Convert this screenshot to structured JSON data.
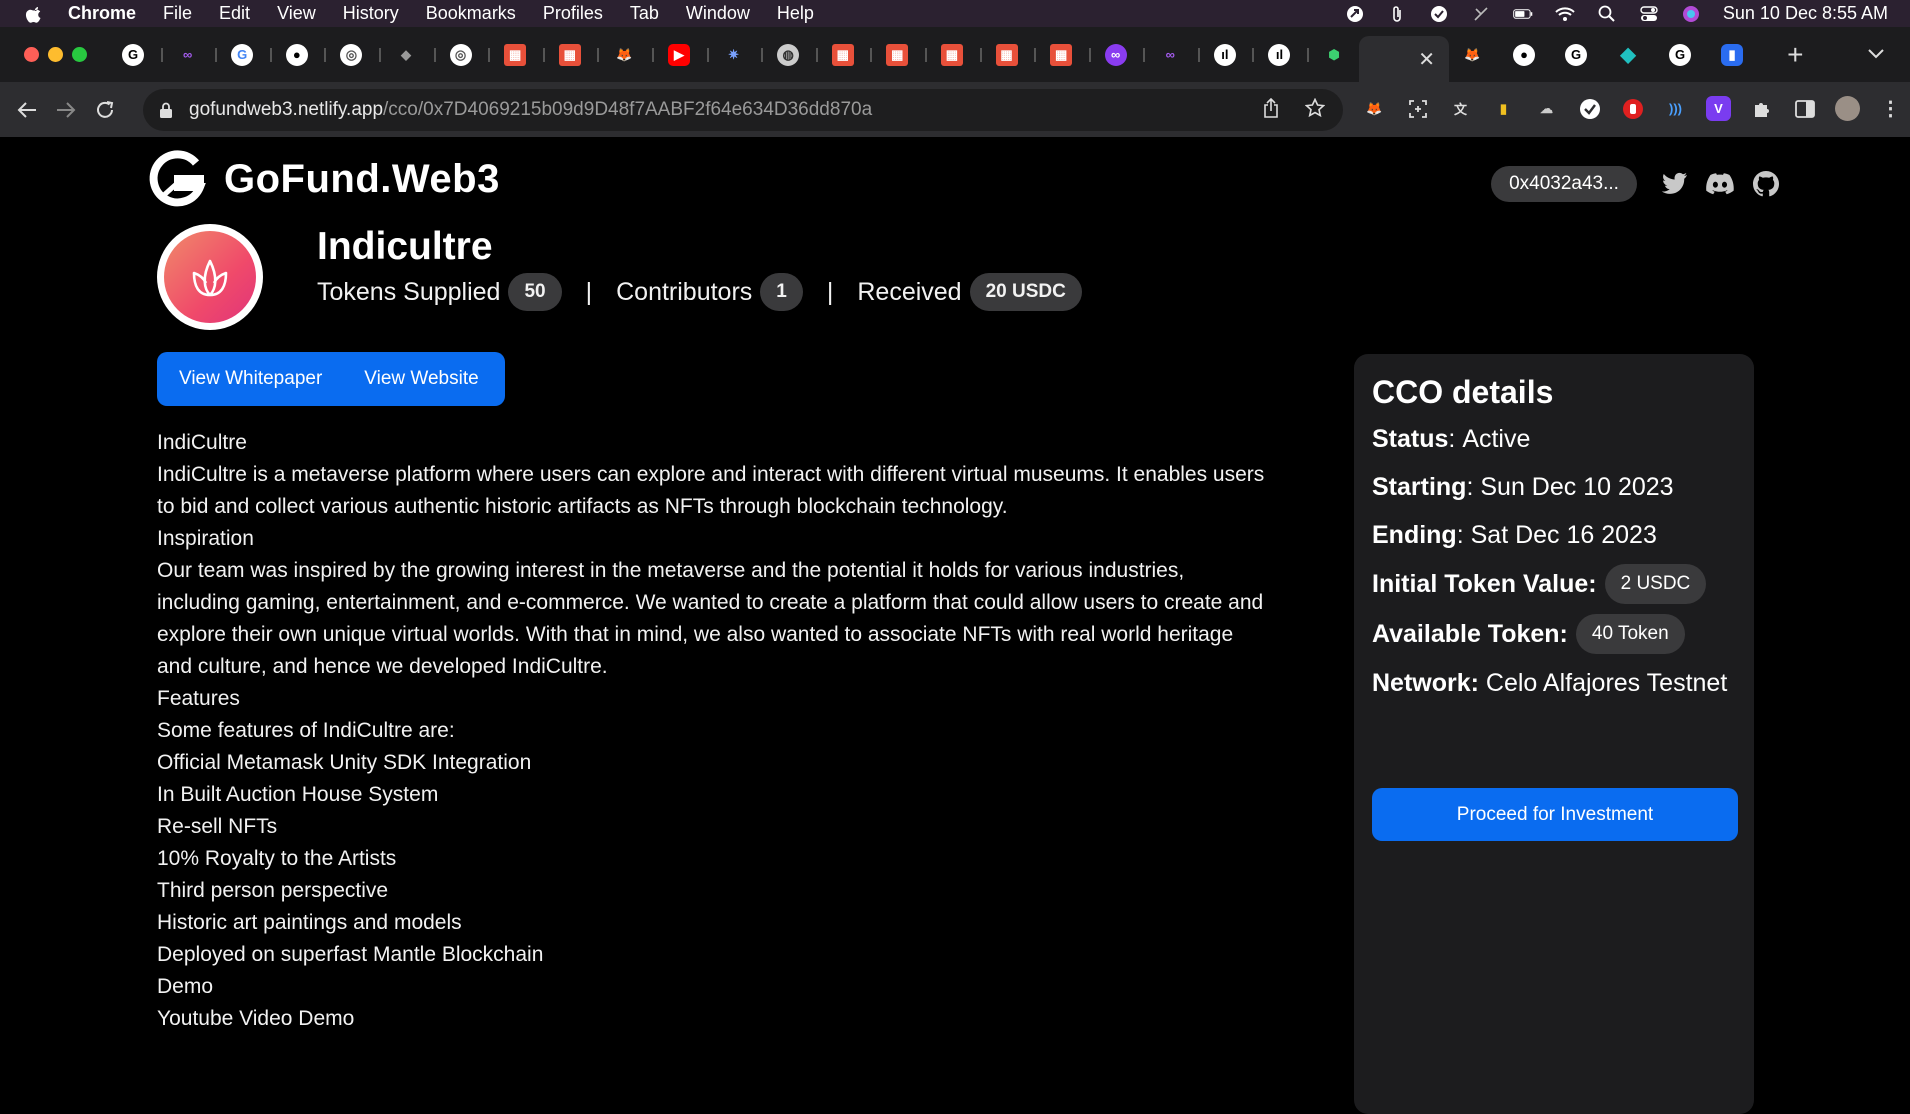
{
  "menubar": {
    "app": "Chrome",
    "items": [
      "File",
      "Edit",
      "View",
      "History",
      "Bookmarks",
      "Profiles",
      "Tab",
      "Window",
      "Help"
    ],
    "clock": "Sun 10 Dec  8:55 AM"
  },
  "tabs": {
    "favicons": [
      "gofund-g",
      "chain-link",
      "google",
      "github",
      "chrome-dev",
      "vector-app",
      "chrome-dev",
      "grid-app",
      "grid-app",
      "metamask",
      "youtube",
      "spark-app",
      "globe",
      "grid-app",
      "grid-app",
      "grid-app",
      "grid-app",
      "grid-app",
      "purple-link",
      "purple-link",
      "chart-app",
      "chart-app",
      "green-cube"
    ],
    "active_close": "✕",
    "after_active": [
      "metamask",
      "github",
      "gofund-g",
      "diamond-app",
      "gofund-g",
      "blue-app"
    ],
    "new_tab": "+"
  },
  "toolbar": {
    "url_host": "gofundweb3.netlify.app",
    "url_path": "/cco/0x7D4069215b09d9D48f7AABF2f64e634D36dd870a"
  },
  "site": {
    "name": "GoFund.Web3",
    "wallet": "0x4032a43...",
    "social": [
      "twitter-icon",
      "discord-icon",
      "github-icon"
    ]
  },
  "project": {
    "title": "Indicultre",
    "tokens_supplied_label": "Tokens Supplied",
    "tokens_supplied": "50",
    "contributors_label": "Contributors",
    "contributors": "1",
    "received_label": "Received",
    "received": "20 USDC",
    "separator": "|",
    "whitepaper_label": "View Whitepaper",
    "website_label": "View Website"
  },
  "description": [
    "IndiCultre",
    "IndiCultre is a metaverse platform where users can explore and interact with different virtual museums. It enables users to bid and collect various authentic historic artifacts as NFTs through blockchain technology.",
    "Inspiration",
    "Our team was inspired by the growing interest in the metaverse and the potential it holds for various industries, including gaming, entertainment, and e-commerce. We wanted to create a platform that could allow users to create and explore their own unique virtual worlds. With that in mind, we also wanted to associate NFTs with real world heritage and culture, and hence we developed IndiCultre.",
    "Features",
    "Some features of IndiCultre are:",
    "Official Metamask Unity SDK Integration",
    "In Built Auction House System",
    "Re-sell NFTs",
    "10% Royalty to the Artists",
    "Third person perspective",
    "Historic art paintings and models",
    "Deployed on superfast Mantle Blockchain",
    "Demo",
    "Youtube Video Demo"
  ],
  "details": {
    "heading": "CCO details",
    "status_label": "Status",
    "status": "Active",
    "starting_label": "Starting",
    "starting": "Sun Dec 10 2023",
    "ending_label": "Ending",
    "ending": "Sat Dec 16 2023",
    "initial_value_label": "Initial Token Value:",
    "initial_value": "2 USDC",
    "available_label": "Available Token:",
    "available": "40 Token",
    "network_label": "Network:",
    "network": "Celo Alfajores Testnet",
    "invest_label": "Proceed for Investment"
  },
  "colors": {
    "accent": "#0a6cf0",
    "panel": "#1c1c1e",
    "badge": "#3a3a3c"
  }
}
